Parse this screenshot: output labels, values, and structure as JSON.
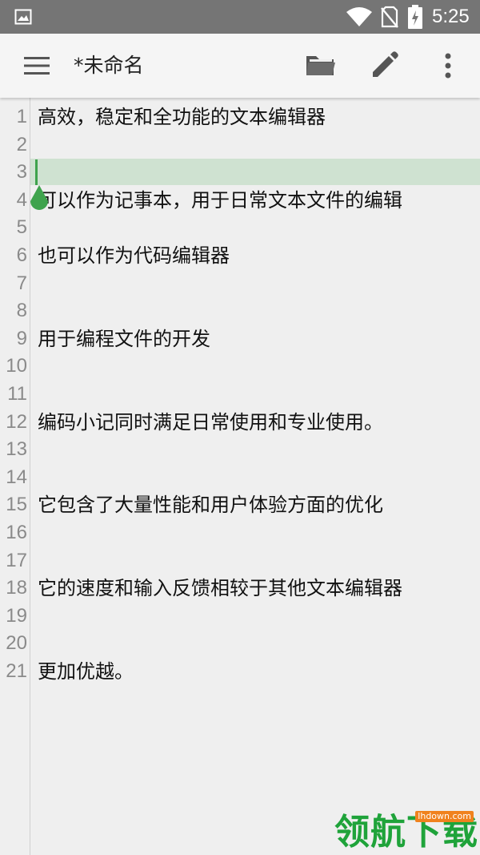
{
  "status_bar": {
    "time": "5:25",
    "icons": [
      "gallery-icon",
      "wifi-icon",
      "no-sim-icon",
      "battery-charging-icon"
    ]
  },
  "toolbar": {
    "title": "*未命名",
    "icons": [
      "menu-icon",
      "folder-open-icon",
      "pencil-icon",
      "more-vert-icon"
    ]
  },
  "editor": {
    "current_line": 3,
    "accent_color": "#3fa34d",
    "lines": [
      {
        "num": "1",
        "text": "高效，稳定和全功能的文本编辑器"
      },
      {
        "num": "2",
        "text": ""
      },
      {
        "num": "3",
        "text": ""
      },
      {
        "num": "4",
        "text": "可以作为记事本，用于日常文本文件的编辑"
      },
      {
        "num": "5",
        "text": ""
      },
      {
        "num": "6",
        "text": "也可以作为代码编辑器"
      },
      {
        "num": "7",
        "text": ""
      },
      {
        "num": "8",
        "text": ""
      },
      {
        "num": "9",
        "text": "用于编程文件的开发"
      },
      {
        "num": "10",
        "text": ""
      },
      {
        "num": "11",
        "text": ""
      },
      {
        "num": "12",
        "text": "编码小记同时满足日常使用和专业使用。"
      },
      {
        "num": "13",
        "text": ""
      },
      {
        "num": "14",
        "text": ""
      },
      {
        "num": "15",
        "text": "它包含了大量性能和用户体验方面的优化"
      },
      {
        "num": "16",
        "text": ""
      },
      {
        "num": "17",
        "text": ""
      },
      {
        "num": "18",
        "text": "它的速度和输入反馈相较于其他文本编辑器"
      },
      {
        "num": "19",
        "text": ""
      },
      {
        "num": "20",
        "text": ""
      },
      {
        "num": "21",
        "text": "更加优越。"
      }
    ]
  },
  "watermark": {
    "text": "领航下载",
    "url": "lhdown.com"
  }
}
